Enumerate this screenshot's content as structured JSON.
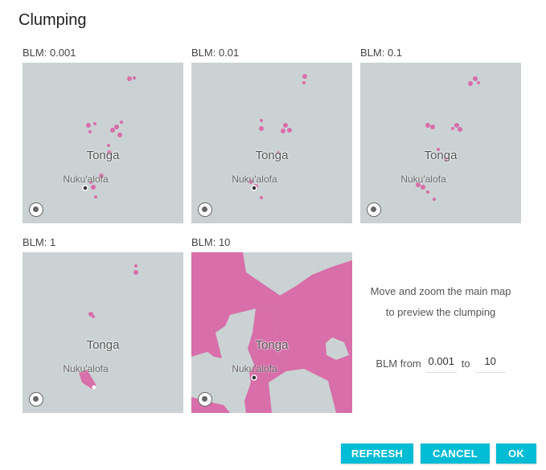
{
  "dialog": {
    "title": "Clumping"
  },
  "previews": [
    {
      "blm_label": "BLM: 0.001",
      "country": "Tonga",
      "city": "Nuku'alofa"
    },
    {
      "blm_label": "BLM: 0.01",
      "country": "Tonga",
      "city": "Nuku'alofa"
    },
    {
      "blm_label": "BLM: 0.1",
      "country": "Tonga",
      "city": "Nuku'alofa"
    },
    {
      "blm_label": "BLM: 1",
      "country": "Tonga",
      "city": "Nuku'alofa"
    },
    {
      "blm_label": "BLM: 10",
      "country": "Tonga",
      "city": "Nuku'alofa"
    }
  ],
  "hint": {
    "line1": "Move and zoom the main map",
    "line2": "to preview the clumping"
  },
  "range": {
    "from_label": "BLM from",
    "from_value": "0.001",
    "to_label": "to",
    "to_value": "10"
  },
  "buttons": {
    "refresh": "REFRESH",
    "cancel": "CANCEL",
    "ok": "OK"
  },
  "colors": {
    "accent": "#00bcd4",
    "planning_unit": "#d86eaa",
    "map_background": "#cbd2d3"
  }
}
